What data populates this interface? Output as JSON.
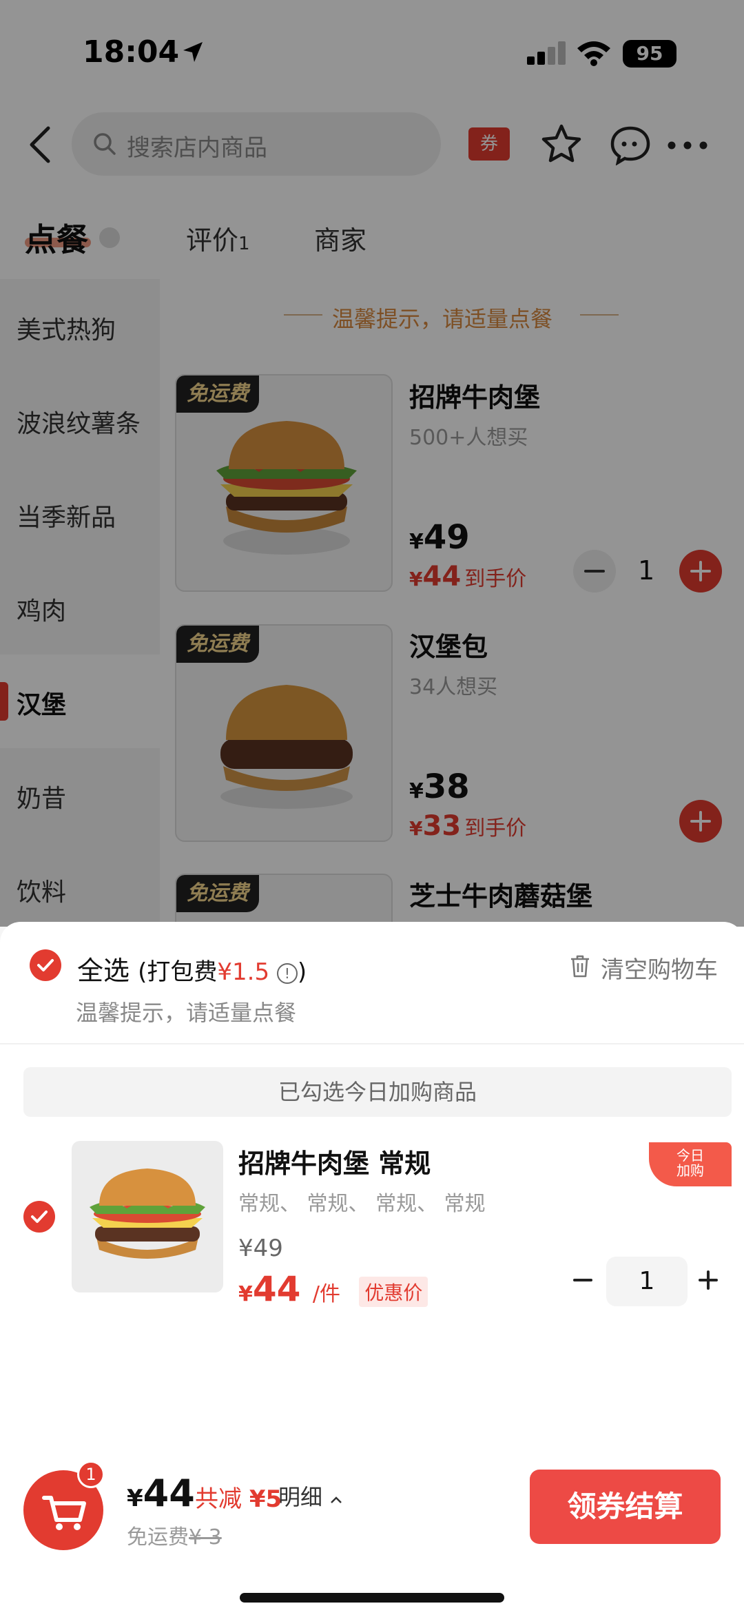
{
  "status_bar": {
    "time": "18:04",
    "battery": "95"
  },
  "header": {
    "search_placeholder": "搜索店内商品",
    "coupon_label": "券"
  },
  "tabs": {
    "order": "点餐",
    "review": "评价",
    "review_count": "1",
    "merchant": "商家"
  },
  "sidebar": {
    "items": [
      "美式热狗",
      "波浪纹薯条",
      "当季新品",
      "鸡肉",
      "汉堡",
      "奶昔",
      "饮料"
    ],
    "active": "汉堡"
  },
  "menu": {
    "notice": "温馨提示，请适量点餐",
    "products": [
      {
        "tag": "免运费",
        "name": "招牌牛肉堡",
        "wants": "500+人想买",
        "price_symbol": "¥",
        "price": "49",
        "final_symbol": "¥",
        "final_price": "44",
        "final_label": "到手价",
        "quantity": "1"
      },
      {
        "tag": "免运费",
        "name": "汉堡包",
        "wants": "34人想买",
        "price_symbol": "¥",
        "price": "38",
        "final_symbol": "¥",
        "final_price": "33",
        "final_label": "到手价"
      },
      {
        "tag": "免运费",
        "name": "芝士牛肉蘑菇堡"
      }
    ]
  },
  "cart": {
    "select_all": "全选",
    "packing_fee_label": "(打包费",
    "packing_fee": "¥1.5",
    "packing_fee_close": ")",
    "tip": "温馨提示，请适量点餐",
    "clear": "清空购物车",
    "banner": "已勾选今日加购商品",
    "item": {
      "name": "招牌牛肉堡 常规",
      "spec": "常规、 常规、 常规、 常规",
      "old_price": "¥49",
      "new_symbol": "¥",
      "new_price": "44",
      "unit": "/件",
      "discount_label": "优惠价",
      "corner_line1": "今日",
      "corner_line2": "加购",
      "quantity": "1"
    }
  },
  "bottom_bar": {
    "cart_count": "1",
    "total_symbol": "¥",
    "total": "44",
    "reduce_label": "共减",
    "reduce_amount": "¥5",
    "detail": "明细",
    "shipping_label": "免运费",
    "shipping_old": "¥ 3",
    "checkout": "领券结算"
  },
  "colors": {
    "accent": "#e23b30",
    "notice": "#d7883e",
    "checkout": "#ed4a45"
  }
}
